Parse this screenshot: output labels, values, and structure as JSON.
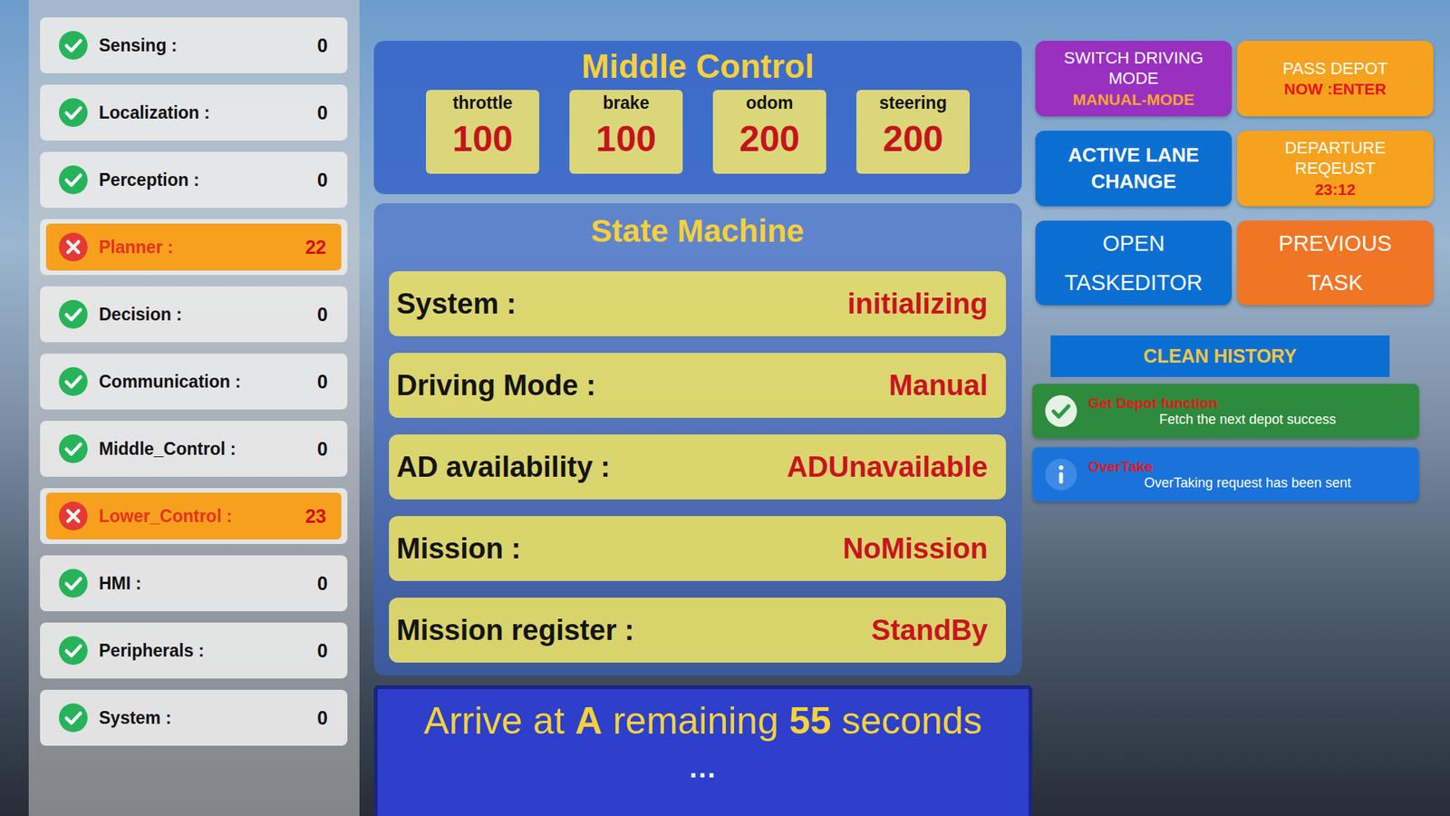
{
  "sidebar": {
    "items": [
      {
        "label": "Sensing :",
        "count": "0",
        "ok": true
      },
      {
        "label": "Localization :",
        "count": "0",
        "ok": true
      },
      {
        "label": "Perception :",
        "count": "0",
        "ok": true
      },
      {
        "label": "Planner :",
        "count": "22",
        "ok": false
      },
      {
        "label": "Decision :",
        "count": "0",
        "ok": true
      },
      {
        "label": "Communication :",
        "count": "0",
        "ok": true
      },
      {
        "label": "Middle_Control :",
        "count": "0",
        "ok": true
      },
      {
        "label": "Lower_Control :",
        "count": "23",
        "ok": false
      },
      {
        "label": "HMI :",
        "count": "0",
        "ok": true
      },
      {
        "label": "Peripherals :",
        "count": "0",
        "ok": true
      },
      {
        "label": "System :",
        "count": "0",
        "ok": true
      }
    ]
  },
  "middle_control": {
    "title": "Middle Control",
    "gauges": [
      {
        "label": "throttle",
        "value": "100"
      },
      {
        "label": "brake",
        "value": "100"
      },
      {
        "label": "odom",
        "value": "200"
      },
      {
        "label": "steering",
        "value": "200"
      }
    ]
  },
  "state_machine": {
    "title": "State Machine",
    "rows": [
      {
        "label": "System :",
        "value": "initializing"
      },
      {
        "label": "Driving Mode :",
        "value": "Manual"
      },
      {
        "label": "AD availability :",
        "value": "ADUnavailable"
      },
      {
        "label": "Mission :",
        "value": "NoMission"
      },
      {
        "label": "Mission register :",
        "value": "StandBy"
      }
    ]
  },
  "banner": {
    "parts": [
      {
        "text": "Arrive at ",
        "bold": false
      },
      {
        "text": "A",
        "bold": true
      },
      {
        "text": " remaining ",
        "bold": false
      },
      {
        "text": "55",
        "bold": true
      },
      {
        "text": " seconds",
        "bold": false
      }
    ],
    "ellipsis": "..."
  },
  "actions": [
    {
      "kind": "caption",
      "label": "SWITCH DRIVING MODE",
      "sub": "MANUAL-MODE",
      "color": "#9a30bf",
      "sub_color": "#f7a531"
    },
    {
      "kind": "caption",
      "label": "PASS DEPOT",
      "sub": "NOW :ENTER",
      "color": "#f7a21e",
      "sub_color": "#e5141c"
    },
    {
      "kind": "bold",
      "label": "ACTIVE LANE CHANGE",
      "sub": "",
      "color": "#0b6fd2",
      "sub_color": "#ffffff"
    },
    {
      "kind": "caption",
      "label": "DEPARTURE REQEUST",
      "sub": "23:12",
      "color": "#f7a21e",
      "sub_color": "#e5141c"
    },
    {
      "kind": "large",
      "label": "OPEN TASKEDITOR",
      "sub": "",
      "color": "#0b6fd2",
      "sub_color": "#ffffff"
    },
    {
      "kind": "large",
      "label": "PREVIOUS TASK",
      "sub": "",
      "color": "#f07524",
      "sub_color": "#ffffff"
    }
  ],
  "clean_history": "CLEAN HISTORY",
  "notifications": [
    {
      "kind": "success",
      "title": "Get Depot function",
      "message": "Fetch the next depot success",
      "color": "#2e8a3c"
    },
    {
      "kind": "info",
      "title": "OverTake",
      "message": "OverTaking request has been sent",
      "color": "#1b73da"
    }
  ]
}
